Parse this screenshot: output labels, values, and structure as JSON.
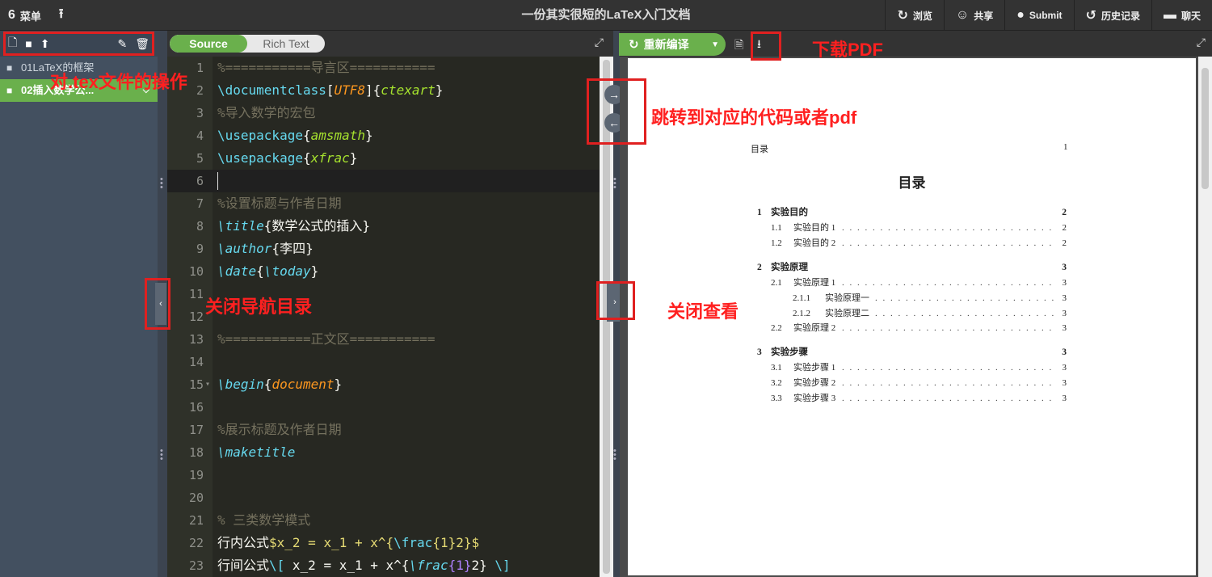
{
  "topbar": {
    "menu_label": "菜单",
    "title": "一份其实很短的LaTeX入门文档",
    "preview_label": "浏览",
    "share_label": "共享",
    "submit_label": "Submit",
    "history_label": "历史记录",
    "chat_label": "聊天"
  },
  "sidebar": {
    "files": [
      {
        "name": "01LaTeX的框架",
        "active": false
      },
      {
        "name": "02插入数学公...",
        "active": true
      }
    ]
  },
  "editor": {
    "mode_source": "Source",
    "mode_rich": "Rich Text"
  },
  "code_lines": [
    {
      "n": "1",
      "html": "<span class=\"c-com\">%===========导言区===========</span>"
    },
    {
      "n": "2",
      "html": "<span class=\"c-cmd\">\\documentclass</span><span class=\"c-txt\">[</span><span class=\"c-arg\">UTF8</span><span class=\"c-txt\">]{</span><span class=\"c-arg2\">ctexart</span><span class=\"c-txt\">}</span>"
    },
    {
      "n": "3",
      "html": "<span class=\"c-com\">%导入数学的宏包</span>"
    },
    {
      "n": "4",
      "html": "<span class=\"c-cmd\">\\usepackage</span><span class=\"c-txt\">{</span><span class=\"c-arg2\">amsmath</span><span class=\"c-txt\">}</span>"
    },
    {
      "n": "5",
      "html": "<span class=\"c-cmd\">\\usepackage</span><span class=\"c-txt\">{</span><span class=\"c-arg2\">xfrac</span><span class=\"c-txt\">}</span>"
    },
    {
      "n": "6",
      "html": ""
    },
    {
      "n": "7",
      "html": "<span class=\"c-com\">%设置标题与作者日期</span>"
    },
    {
      "n": "8",
      "html": "<span class=\"c-macro\">\\title</span><span class=\"c-txt\">{数学公式的插入}</span>"
    },
    {
      "n": "9",
      "html": "<span class=\"c-macro\">\\author</span><span class=\"c-txt\">{李四}</span>"
    },
    {
      "n": "10",
      "html": "<span class=\"c-macro\">\\date</span><span class=\"c-txt\">{</span><span class=\"c-macro\">\\today</span><span class=\"c-txt\">}</span>"
    },
    {
      "n": "11",
      "html": ""
    },
    {
      "n": "12",
      "html": ""
    },
    {
      "n": "13",
      "html": "<span class=\"c-com\">%===========正文区===========</span>"
    },
    {
      "n": "14",
      "html": ""
    },
    {
      "n": "15",
      "html": "<span class=\"c-macro\">\\begin</span><span class=\"c-txt\">{</span><span class=\"c-arg\">document</span><span class=\"c-txt\">}</span>"
    },
    {
      "n": "16",
      "html": ""
    },
    {
      "n": "17",
      "html": "<span class=\"c-com\">%展示标题及作者日期</span>"
    },
    {
      "n": "18",
      "html": "<span class=\"c-macro\">\\maketitle</span>"
    },
    {
      "n": "19",
      "html": ""
    },
    {
      "n": "20",
      "html": ""
    },
    {
      "n": "21",
      "html": "<span class=\"c-com\">% 三类数学模式</span>"
    },
    {
      "n": "22",
      "html": "<span class=\"c-txt\">行内公式</span><span class=\"c-dl\">$x_2 = x_1 + x^{</span><span class=\"c-cmd\">\\frac</span><span class=\"c-dl\">{1}2}$</span>"
    },
    {
      "n": "23",
      "html": "<span class=\"c-txt\">行间公式</span><span class=\"c-cmd\">\\[</span><span class=\"c-txt\"> x_2 = x_1 + x^{</span><span class=\"c-macro\">\\frac</span><span class=\"c-num\">{1}</span><span class=\"c-txt\">2} </span><span class=\"c-cmd\">\\]</span>"
    }
  ],
  "pdf_toolbar": {
    "recompile_label": "重新编译"
  },
  "pdf": {
    "header_left": "目录",
    "header_right": "1",
    "toc_title": "目录",
    "toc": [
      {
        "level": 1,
        "num": "1",
        "title": "实验目的",
        "page": "2"
      },
      {
        "level": 2,
        "num": "1.1",
        "title": "实验目的 1",
        "page": "2"
      },
      {
        "level": 2,
        "num": "1.2",
        "title": "实验目的 2",
        "page": "2"
      },
      {
        "level": 1,
        "num": "2",
        "title": "实验原理",
        "page": "3"
      },
      {
        "level": 2,
        "num": "2.1",
        "title": "实验原理 1",
        "page": "3"
      },
      {
        "level": 3,
        "num": "2.1.1",
        "title": "实验原理一",
        "page": "3"
      },
      {
        "level": 3,
        "num": "2.1.2",
        "title": "实验原理二",
        "page": "3"
      },
      {
        "level": 2,
        "num": "2.2",
        "title": "实验原理 2",
        "page": "3"
      },
      {
        "level": 1,
        "num": "3",
        "title": "实验步骤",
        "page": "3"
      },
      {
        "level": 2,
        "num": "3.1",
        "title": "实验步骤 1",
        "page": "3"
      },
      {
        "level": 2,
        "num": "3.2",
        "title": "实验步骤 2",
        "page": "3"
      },
      {
        "level": 2,
        "num": "3.3",
        "title": "实验步骤 3",
        "page": "3"
      }
    ]
  },
  "annotations": {
    "file_ops": "对.tex文件的操作",
    "download_pdf": "下载PDF",
    "sync": "跳转到对应的代码或者pdf",
    "close_nav": "关闭导航目录",
    "close_view": "关闭查看"
  },
  "colors": {
    "accent_green": "#6ab04c",
    "annotation_red": "#e02020",
    "editor_bg": "#272822"
  }
}
